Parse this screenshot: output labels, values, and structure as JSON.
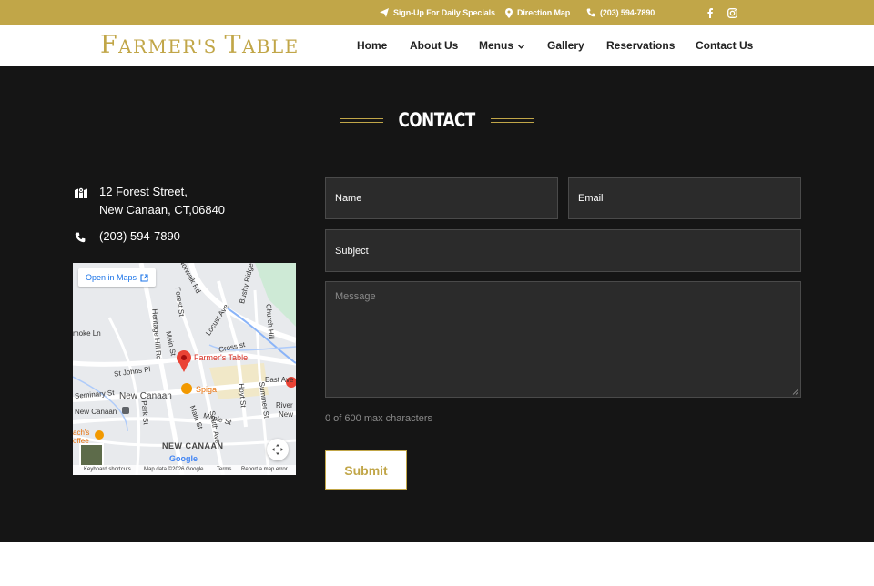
{
  "topbar": {
    "signup_label": "Sign-Up For Daily Specials",
    "signup_icon": "paper-plane-icon",
    "direction_label": "Direction Map",
    "direction_icon": "map-pin-icon",
    "phone_label": "(203) 594-7890",
    "phone_icon": "phone-icon",
    "social": [
      "facebook-icon",
      "instagram-icon"
    ],
    "background": "#c1a648"
  },
  "header": {
    "logo_text": "Farmer's Table",
    "nav": [
      {
        "label": "Home"
      },
      {
        "label": "About Us"
      },
      {
        "label": "Menus",
        "has_dropdown": true
      },
      {
        "label": "Gallery"
      },
      {
        "label": "Reservations"
      },
      {
        "label": "Contact Us"
      }
    ]
  },
  "contact": {
    "title": "CONTACT",
    "address_line1": "12 Forest Street,",
    "address_line2": "New Canaan, CT,06840",
    "phone": "(203) 594-7890",
    "map": {
      "open_in_maps": "Open in Maps",
      "marker_label": "Farmer's Table",
      "poi_label": "Spiga",
      "labels": {
        "norwalk_rd": "Norwalk Rd",
        "forest_st": "Forest St",
        "locust_ave": "Locust Ave",
        "heritage_hill": "Heritage Hill Rd",
        "main_st_1": "Main St",
        "main_st_2": "Main St",
        "cross_st": "Cross st",
        "st_johns": "St Johns Pl",
        "east_ave": "East Ave",
        "seminary": "Seminary St",
        "new_canaan": "New Canaan",
        "new_canaan_station": "New Canaan",
        "new_canaan_caps": "NEW CANAAN",
        "park_st": "Park St",
        "maple_st": "Maple St",
        "hoyt_st": "Hoyt St",
        "summer_st": "Summer St",
        "river_ph": "River",
        "new_ph": "New",
        "smoke_ln": "moke Ln",
        "church_hill": "Church Hill",
        "south_ave": "South Ave",
        "bushy_ridge": "Bushy Ridge",
        "coffee": "ach's\noffee"
      },
      "footer": {
        "shortcuts": "Keyboard shortcuts",
        "mapdata": "Map data ©2026 Google",
        "terms": "Terms",
        "report": "Report a map error"
      },
      "google_logo": "Google"
    },
    "form": {
      "name_placeholder": "Name",
      "email_placeholder": "Email",
      "subject_placeholder": "Subject",
      "message_placeholder": "Message",
      "char_counter": "0 of 600 max characters",
      "submit_label": "Submit"
    }
  },
  "colors": {
    "accent": "#c1a648",
    "dark_bg": "#151515",
    "field_bg": "#2b2b2b"
  }
}
